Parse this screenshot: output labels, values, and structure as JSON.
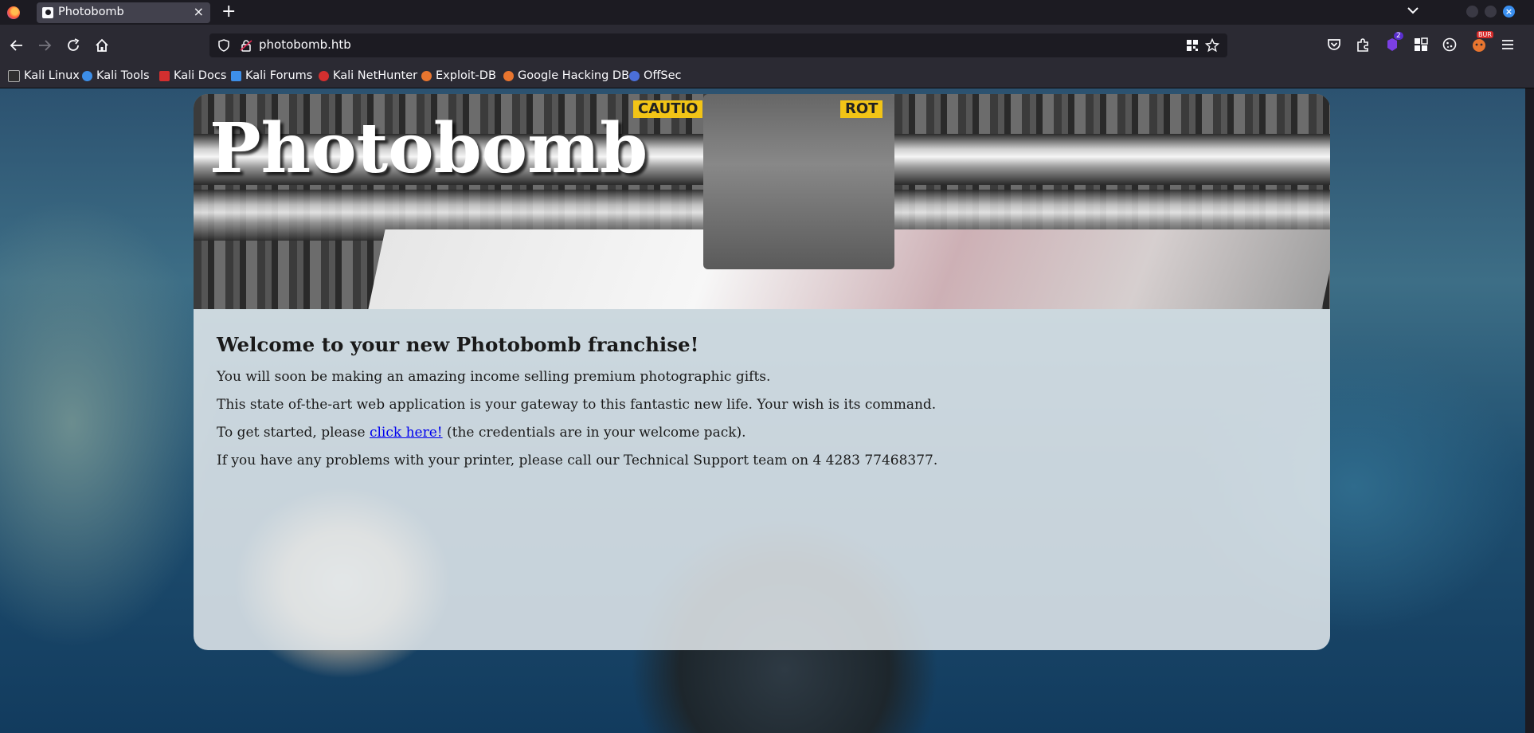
{
  "browser": {
    "tab_title": "Photobomb",
    "url": "photobomb.htb",
    "extension_badges": {
      "notifications": "2",
      "bur": "BUR"
    }
  },
  "bookmarks": [
    {
      "label": "Kali Linux",
      "color": "#2f2f2f"
    },
    {
      "label": "Kali Tools",
      "color": "#3d8ee8"
    },
    {
      "label": "Kali Docs",
      "color": "#d32f2f"
    },
    {
      "label": "Kali Forums",
      "color": "#3d8ee8"
    },
    {
      "label": "Kali NetHunter",
      "color": "#d32f2f"
    },
    {
      "label": "Exploit-DB",
      "color": "#e8752f"
    },
    {
      "label": "Google Hacking DB",
      "color": "#e8752f"
    },
    {
      "label": "OffSec",
      "color": "#4b6fd8"
    }
  ],
  "page": {
    "site_title": "Photobomb",
    "heading": "Welcome to your new Photobomb franchise!",
    "para1": "You will soon be making an amazing income selling premium photographic gifts.",
    "para2": "This state of-the-art web application is your gateway to this fantastic new life. Your wish is its command.",
    "para3_before": "To get started, please ",
    "para3_link": "click here!",
    "para3_after": " (the credentials are in your welcome pack).",
    "para4": "If you have any problems with your printer, please call our Technical Support team on 4 4283 77468377.",
    "hero_labels": [
      "CAUTIO",
      "ROT"
    ]
  },
  "colors": {
    "chrome_dark": "#1c1b22",
    "chrome_toolbar": "#2b2a33",
    "link": "#0000ee",
    "card": "#e4eaee"
  }
}
